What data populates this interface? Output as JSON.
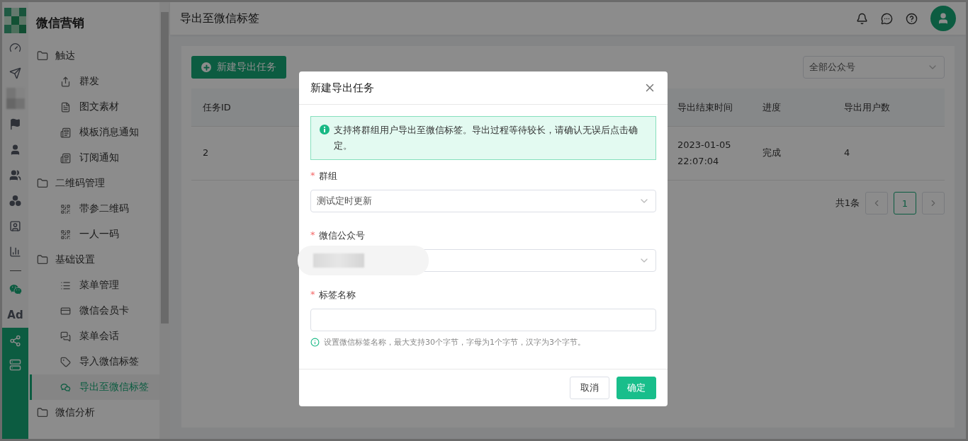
{
  "app": {
    "title": "微信营销"
  },
  "rail": [
    {
      "kind": "gauge",
      "selected": false
    },
    {
      "kind": "send",
      "selected": false
    },
    {
      "kind": "redacted",
      "selected": false
    },
    {
      "kind": "flag",
      "selected": false
    },
    {
      "kind": "user",
      "selected": false
    },
    {
      "kind": "users",
      "selected": false
    },
    {
      "kind": "cluster",
      "selected": false
    },
    {
      "kind": "contact",
      "selected": false
    },
    {
      "kind": "chart",
      "selected": false
    },
    {
      "kind": "divider"
    },
    {
      "kind": "wechat",
      "selected": false
    },
    {
      "kind": "text",
      "label": "Ad",
      "selected": false
    },
    {
      "kind": "network",
      "selected": true
    },
    {
      "kind": "server",
      "selected": true
    }
  ],
  "sidebar": {
    "groups": [
      {
        "label": "触达",
        "children": [
          {
            "label": "群发",
            "kind": "share",
            "selected": false
          },
          {
            "label": "图文素材",
            "kind": "doc",
            "selected": false
          },
          {
            "label": "模板消息通知",
            "kind": "template",
            "selected": false
          },
          {
            "label": "订阅通知",
            "kind": "template",
            "selected": false
          }
        ]
      },
      {
        "label": "二维码管理",
        "children": [
          {
            "label": "带参二维码",
            "kind": "qr",
            "selected": false
          },
          {
            "label": "一人一码",
            "kind": "qr",
            "selected": false
          }
        ]
      },
      {
        "label": "基础设置",
        "children": [
          {
            "label": "菜单管理",
            "kind": "list",
            "selected": false
          },
          {
            "label": "微信会员卡",
            "kind": "card",
            "selected": false
          },
          {
            "label": "菜单会话",
            "kind": "chat",
            "selected": false
          },
          {
            "label": "导入微信标签",
            "kind": "tag",
            "selected": false
          },
          {
            "label": "导出至微信标签",
            "kind": "wechat",
            "selected": true
          }
        ]
      },
      {
        "label": "微信分析"
      }
    ]
  },
  "header": {
    "title": "导出至微信标签"
  },
  "toolbar": {
    "new_button": "新建导出任务",
    "account_filter": "全部公众号"
  },
  "table": {
    "columns": [
      "任务ID",
      "导出结束时间",
      "进度",
      "导出用户数"
    ],
    "rows": [
      {
        "cells": [
          "2",
          "2023-01-05 22:07:04",
          "完成",
          "4"
        ]
      }
    ]
  },
  "pagination": {
    "total": "共1条",
    "pages": [
      {
        "label": "1",
        "selected": true
      }
    ]
  },
  "dialog": {
    "title": "新建导出任务",
    "notice": "支持将群组用户导出至微信标签。导出过程等待较长，请确认无误后点击确定。",
    "fields": [
      {
        "kind": "select",
        "required_mark": "*",
        "label": "群组",
        "value": "测试定时更新"
      },
      {
        "kind": "redacted-select",
        "required_mark": "*",
        "label": "微信公众号"
      },
      {
        "kind": "input",
        "required_mark": "*",
        "label": "标签名称",
        "hint": "设置微信标签名称，最大支持30个字节，字母为1个字节，汉字为3个字节。"
      }
    ],
    "buttons": [
      {
        "label": "取消",
        "kind": "default"
      },
      {
        "label": "确定",
        "kind": "primary"
      }
    ]
  }
}
